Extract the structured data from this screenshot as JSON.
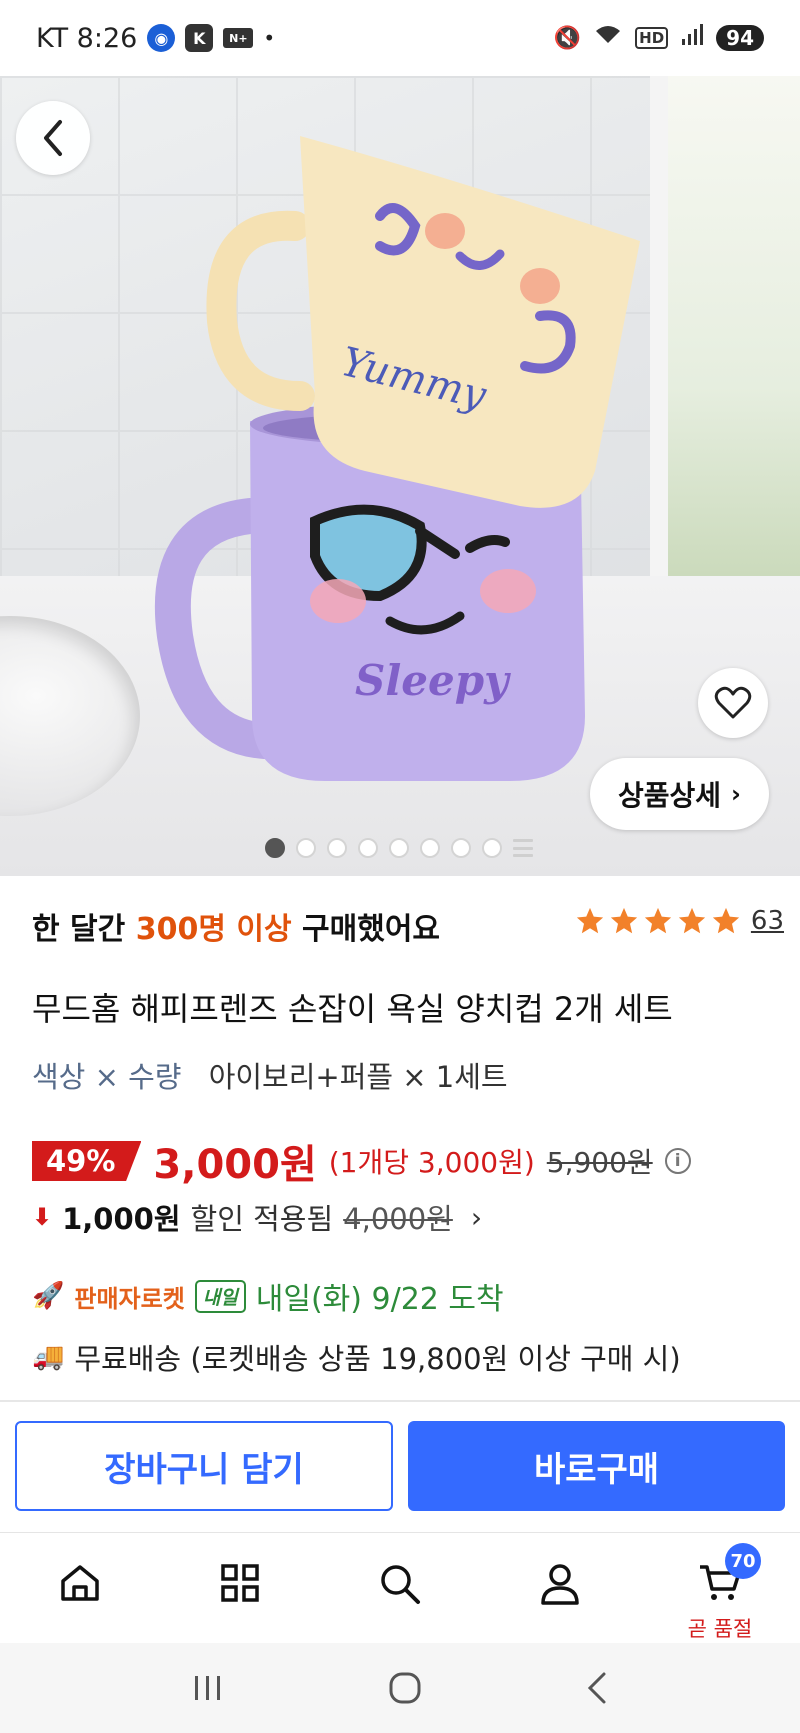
{
  "status_bar": {
    "carrier_time": "KT 8:26",
    "app_badge": "N+",
    "battery": "94"
  },
  "hero": {
    "mug_text_top": "Yummy",
    "mug_text_bottom": "Sleepy",
    "detail_button": "상품상세",
    "carousel_count": 8,
    "carousel_active": 0
  },
  "product": {
    "buyers_prefix": "한 달간",
    "buyers_highlight": "300명 이상",
    "buyers_suffix": "구매했어요",
    "rating": 5,
    "review_count": "63",
    "title": "무드홈 해피프렌즈 손잡이 욕실 양치컵 2개 세트",
    "option_label": "색상 × 수량",
    "option_value": "아이보리+퍼플 × 1세트"
  },
  "price": {
    "discount": "49%",
    "sale_price": "3,000원",
    "unit_price": "(1개당 3,000원)",
    "original_price": "5,900원",
    "coupon_amount": "1,000원",
    "coupon_text": "할인 적용됨",
    "coupon_original": "4,000원"
  },
  "delivery": {
    "rocket_label": "판매자로켓",
    "tomorrow_badge": "내일",
    "arrival": "내일(화) 9/22 도착",
    "shipping": "무료배송 (로켓배송 상품 19,800원 이상 구매 시)"
  },
  "actions": {
    "cart_button": "장바구니 담기",
    "buy_button": "바로구매"
  },
  "bottom_nav": {
    "cart_badge": "70",
    "cart_label": "곧 품절"
  },
  "colors": {
    "accent": "#346aff",
    "sale_red": "#d31b1b",
    "highlight_orange": "#e0520b",
    "delivery_green": "#2d8b3a",
    "star": "#f2812a"
  }
}
